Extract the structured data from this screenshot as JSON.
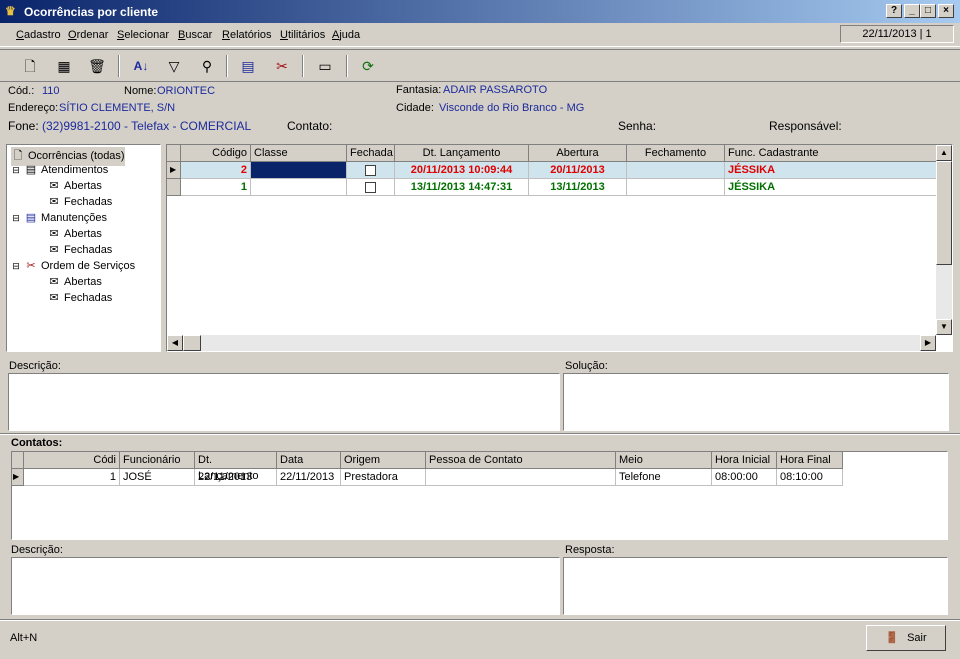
{
  "window": {
    "title": "Ocorrências por cliente",
    "buttons": [
      "?",
      "_",
      "□",
      "×"
    ]
  },
  "menu": [
    {
      "label": "Cadastro",
      "accel": "C",
      "rest": "adastro"
    },
    {
      "label": "Ordenar",
      "accel": "O",
      "rest": "rdenar"
    },
    {
      "label": "Selecionar",
      "accel": "S",
      "rest": "elecionar"
    },
    {
      "label": "Buscar",
      "accel": "B",
      "rest": "uscar"
    },
    {
      "label": "Relatórios",
      "accel": "R",
      "rest": "elatórios"
    },
    {
      "label": "Utilitários",
      "accel": "U",
      "rest": "tilitários"
    },
    {
      "label": "Ajuda",
      "accel": "A",
      "rest": "juda"
    }
  ],
  "status_date": "22/11/2013 | 1",
  "client": {
    "cod_label": "Cód.:",
    "cod": "110",
    "nome_label": "Nome:",
    "nome": "ORIONTEC",
    "fantasia_label": "Fantasia:",
    "fantasia": "ADAIR PASSAROTO",
    "endereco_label": "Endereço:",
    "endereco": "SÍTIO CLEMENTE, S/N",
    "cidade_label": "Cidade:",
    "cidade": "Visconde do Rio Branco - MG",
    "fone_label": "Fone:",
    "fone": "(32)9981-2100 - Telefax - COMERCIAL",
    "contato_label": "Contato:",
    "senha_label": "Senha:",
    "responsavel_label": "Responsável:"
  },
  "tree": {
    "root": "Ocorrências (todas)",
    "atendimentos": "Atendimentos",
    "manutencoes": "Manutenções",
    "ordem": "Ordem de Serviços",
    "abertas": "Abertas",
    "fechadas": "Fechadas"
  },
  "ocorrencias": {
    "headers": [
      "Código",
      "Classe",
      "Fechada",
      "Dt. Lançamento",
      "Abertura",
      "Fechamento",
      "Func. Cadastrante"
    ],
    "rows": [
      {
        "codigo": "2",
        "classe": "",
        "dt": "20/11/2013 10:09:44",
        "abertura": "20/11/2013",
        "fechamento": "",
        "func": "JÉSSIKA",
        "color": "red"
      },
      {
        "codigo": "1",
        "classe": "",
        "dt": "13/11/2013 14:47:31",
        "abertura": "13/11/2013",
        "fechamento": "",
        "func": "JÉSSIKA",
        "color": "green"
      }
    ]
  },
  "descricao_label": "Descrição:",
  "solucao_label": "Solução:",
  "contatos": {
    "title": "Contatos:",
    "headers": [
      "Códi",
      "Funcionário",
      "Dt. Lançamento",
      "Data",
      "Origem",
      "Pessoa de Contato",
      "Meio",
      "Hora Inicial",
      "Hora Final"
    ],
    "rows": [
      {
        "codi": "1",
        "func": "JOSÉ",
        "dt": "22/11/2013",
        "data": "22/11/2013",
        "origem": "Prestadora",
        "pessoa": "",
        "meio": "Telefone",
        "hi": "08:00:00",
        "hf": "08:10:00"
      }
    ]
  },
  "descricao2_label": "Descrição:",
  "resposta_label": "Resposta:",
  "footer": {
    "hint": "Alt+N",
    "sair": "Sair"
  }
}
